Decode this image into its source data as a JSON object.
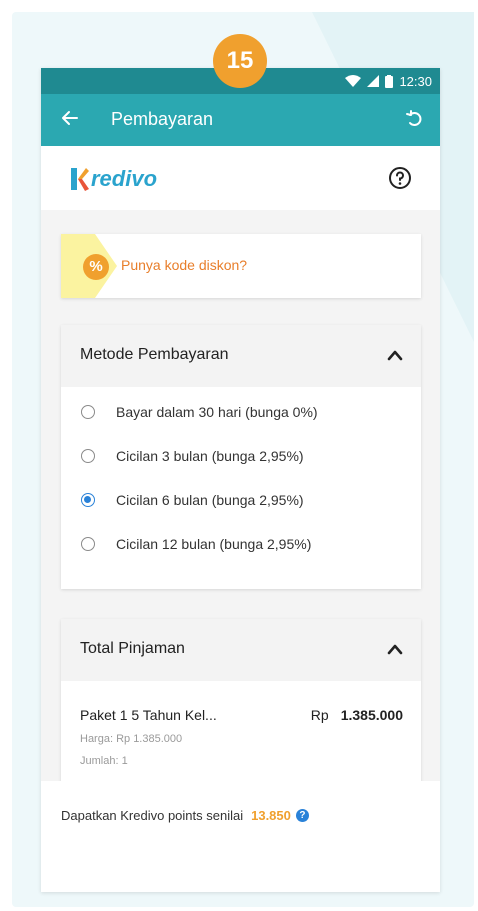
{
  "step_number": "15",
  "status_bar": {
    "time": "12:30"
  },
  "app_bar": {
    "title": "Pembayaran"
  },
  "brand": {
    "logo_text": "redivo"
  },
  "promo": {
    "icon_symbol": "%",
    "text": "Punya kode diskon?"
  },
  "payment_method": {
    "title": "Metode Pembayaran",
    "options": [
      {
        "label": "Bayar dalam 30 hari (bunga 0%)",
        "selected": false
      },
      {
        "label": "Cicilan 3 bulan (bunga 2,95%)",
        "selected": false
      },
      {
        "label": "Cicilan 6 bulan (bunga 2,95%)",
        "selected": true
      },
      {
        "label": "Cicilan 12 bulan (bunga 2,95%)",
        "selected": false
      }
    ]
  },
  "total": {
    "title": "Total Pinjaman",
    "item_name": "Paket 1 5 Tahun Kel...",
    "currency": "Rp",
    "amount": "1.385.000",
    "price_line": "Harga: Rp 1.385.000",
    "quantity_line": "Jumlah: 1"
  },
  "footer": {
    "text": "Dapatkan Kredivo points senilai",
    "points": "13.850",
    "info_symbol": "?"
  },
  "colors": {
    "status_bar": "#1f8a91",
    "app_bar": "#2ba8b1",
    "badge": "#f0a02e",
    "radio_selected": "#2a82d8",
    "promo_text": "#e87e2a",
    "logo_blue": "#2aa3cd"
  },
  "icons": {
    "back": "arrow-left-icon",
    "refresh": "refresh-icon",
    "help": "help-circle-icon",
    "discount": "percent-icon",
    "collapse": "chevron-up-icon",
    "info": "info-icon"
  }
}
